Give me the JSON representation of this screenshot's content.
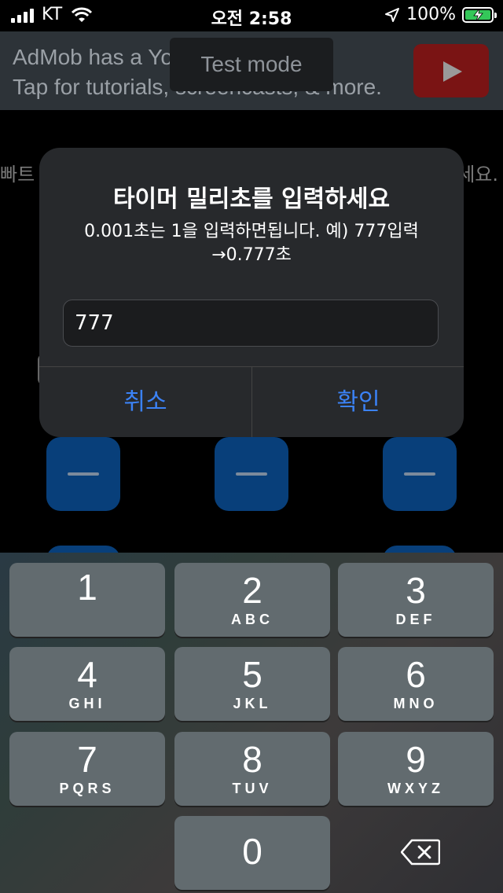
{
  "status_bar": {
    "carrier": "KT",
    "time": "오전 2:58",
    "battery_percent": "100%",
    "battery_color": "#34c759"
  },
  "ad_banner": {
    "line1": "AdMob has a Yo",
    "line2": "Tap for tutorials, screencasts, & more.",
    "badge": "Test mode",
    "icon": "youtube-play-icon"
  },
  "background": {
    "text_left": "빠트",
    "text_right": "세요."
  },
  "alert": {
    "title": "타이머 밀리초를 입력하세요",
    "message": "0.001초는 1을 입력하면됩니다. 예) 777입력 →0.777초",
    "input_value": "777",
    "cancel_label": "취소",
    "ok_label": "확인",
    "button_color": "#3b82f6"
  },
  "keypad": {
    "keys": [
      {
        "num": "1",
        "letters": ""
      },
      {
        "num": "2",
        "letters": "ABC"
      },
      {
        "num": "3",
        "letters": "DEF"
      },
      {
        "num": "4",
        "letters": "GHI"
      },
      {
        "num": "5",
        "letters": "JKL"
      },
      {
        "num": "6",
        "letters": "MNO"
      },
      {
        "num": "7",
        "letters": "PQRS"
      },
      {
        "num": "8",
        "letters": "TUV"
      },
      {
        "num": "9",
        "letters": "WXYZ"
      },
      {
        "num": "0",
        "letters": ""
      }
    ],
    "delete_icon": "backspace-icon"
  }
}
